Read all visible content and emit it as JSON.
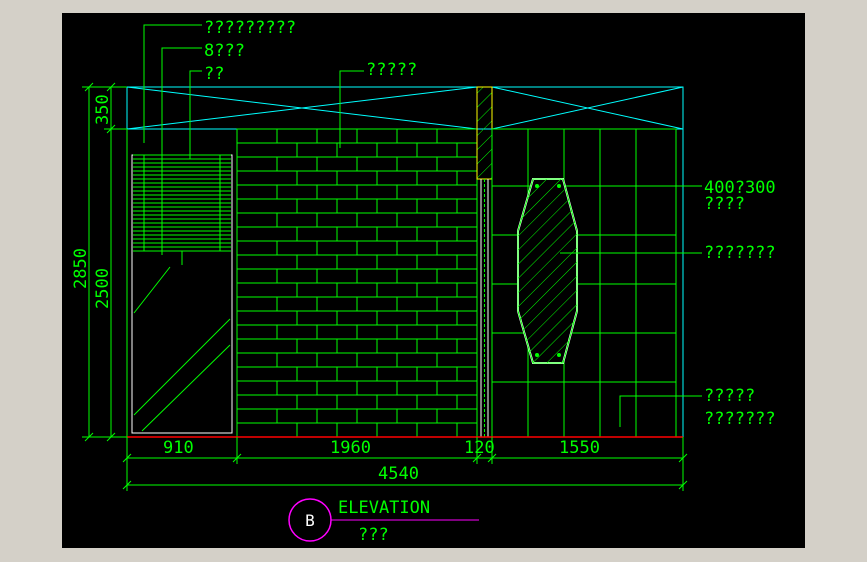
{
  "colors": {
    "background": "#000000",
    "frame": "#d4d0c8",
    "green": "#00ff00",
    "cyan": "#00ffff",
    "yellow": "#ffff00",
    "red": "#ff0000",
    "magenta": "#ff00ff"
  },
  "leaders": {
    "top_1": "?????????",
    "top_2": "8???",
    "top_3": "??",
    "brick": "?????",
    "tile_size": "400?300",
    "tile_note": "????",
    "glass": "???????",
    "bottom_1": "?????",
    "bottom_2": "???????"
  },
  "dimensions": {
    "vertical": {
      "top": "350",
      "total": "2850",
      "wall": "2500"
    },
    "horizontal": {
      "seg1": "910",
      "seg2": "1960",
      "seg3": "120",
      "seg4": "1550",
      "total": "4540"
    }
  },
  "title": {
    "badge": "B",
    "name": "ELEVATION",
    "subtitle": "???"
  }
}
